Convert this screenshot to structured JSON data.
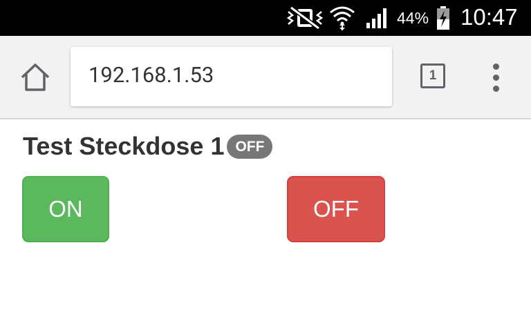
{
  "status_bar": {
    "time": "10:47",
    "battery_percent": "44%",
    "icons": [
      "vibrate-mute-icon",
      "wifi-icon",
      "signal-icon",
      "battery-charging-icon"
    ]
  },
  "browser": {
    "url": "192.168.1.53",
    "tab_count": "1",
    "icons": [
      "home-icon",
      "overflow-menu-icon"
    ]
  },
  "page": {
    "title": "Test Steckdose 1",
    "status_badge": "OFF",
    "on_button": "ON",
    "off_button": "OFF"
  },
  "colors": {
    "on_button": "#5cb85c",
    "off_button": "#d9534f",
    "badge": "#777777"
  }
}
